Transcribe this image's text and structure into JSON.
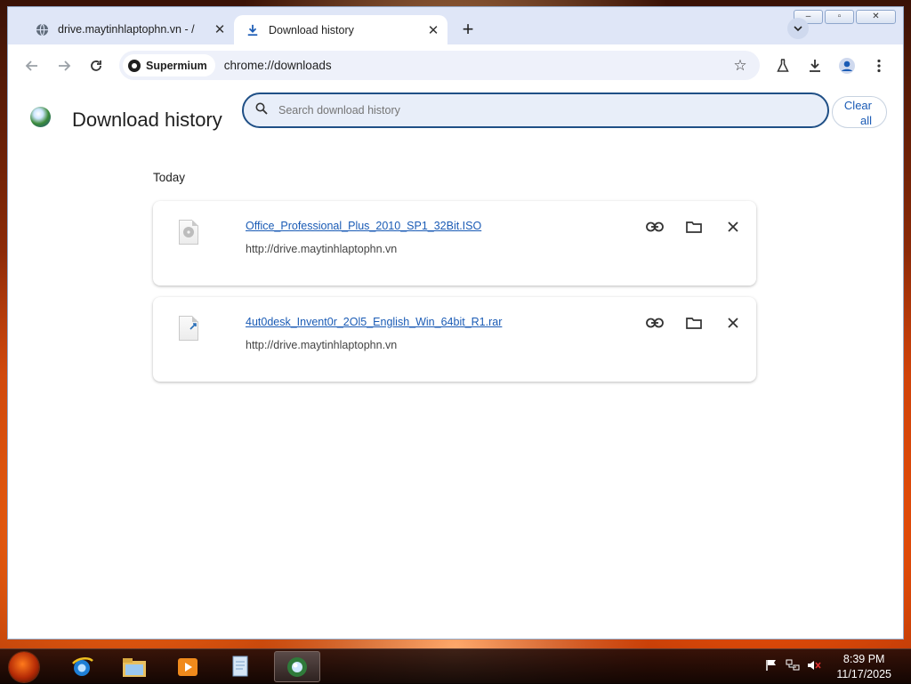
{
  "window": {
    "controls": {
      "minimize": "–",
      "maximize": "▫",
      "close": "✕"
    }
  },
  "tabs": [
    {
      "title": "drive.maytinhlaptophn.vn - /",
      "icon": "globe-icon",
      "active": false
    },
    {
      "title": "Download history",
      "icon": "download-icon",
      "active": true
    }
  ],
  "toolbar": {
    "site_chip": "Supermium",
    "url": "chrome://downloads"
  },
  "page": {
    "title": "Download history",
    "search_placeholder": "Search download history",
    "clear_all": "Clear all",
    "section_date": "Today",
    "downloads": [
      {
        "file_name": "Office_Professional_Plus_2010_SP1_32Bit.ISO",
        "url": "http://drive.maytinhlaptophn.vn",
        "icon": "disc-file-icon"
      },
      {
        "file_name": "4ut0desk_Invent0r_2Ol5_English_Win_64bit_R1.rar",
        "url": "http://drive.maytinhlaptophn.vn",
        "icon": "archive-file-icon"
      }
    ]
  },
  "taskbar": {
    "apps": [
      "internet-explorer-icon",
      "file-explorer-icon",
      "media-player-icon",
      "document-icon",
      "supermium-icon"
    ],
    "clock_time": "8:39 PM",
    "clock_date": "11/17/2025"
  },
  "colors": {
    "link": "#1a5bb5",
    "search_border": "#1f4f86",
    "frame": "#dfe6f7"
  }
}
